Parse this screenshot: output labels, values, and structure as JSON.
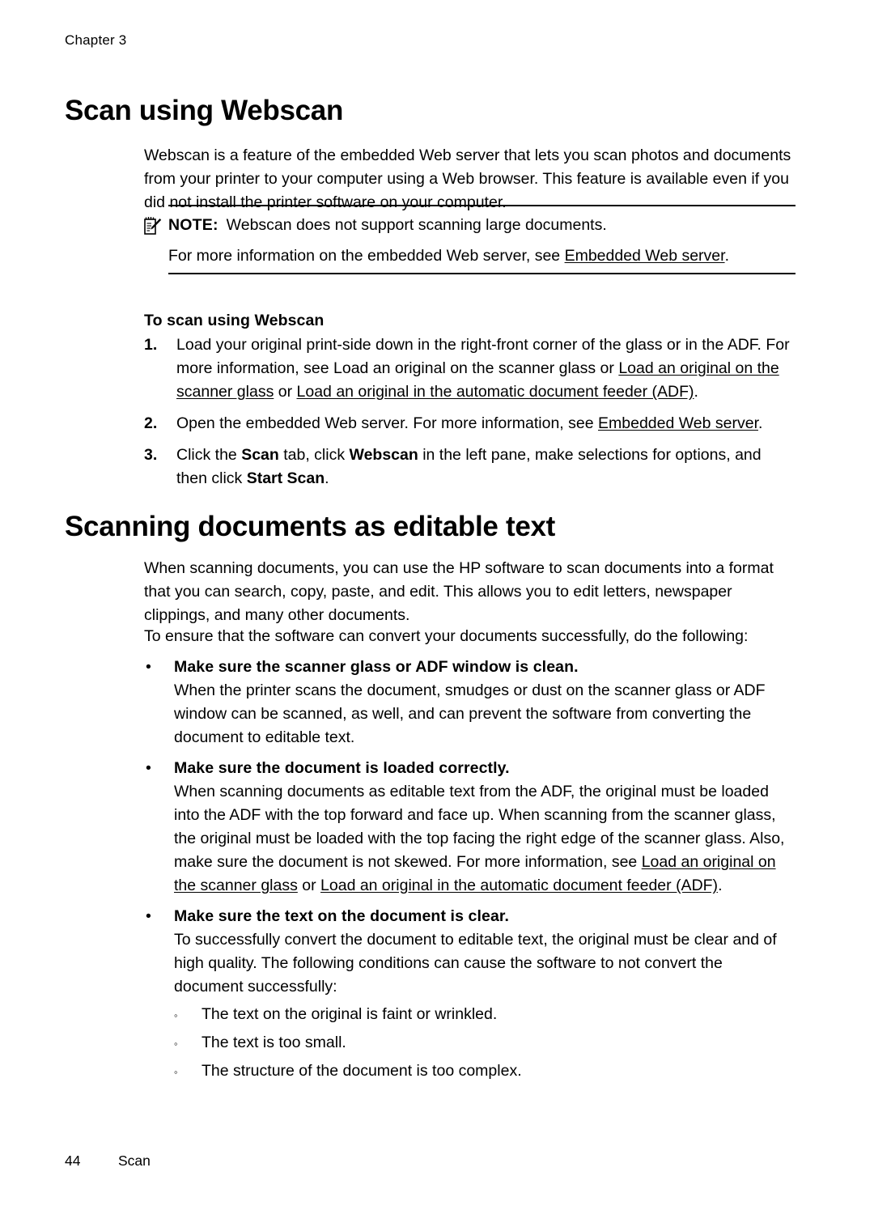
{
  "page": {
    "chapter_header": "Chapter 3",
    "footer_page_number": "44",
    "footer_section": "Scan"
  },
  "sections": [
    {
      "heading": "Scan using Webscan",
      "intro": "Webscan is a feature of the embedded Web server that lets you scan photos and documents from your printer to your computer using a Web browser. This feature is available even if you did not install the printer software on your computer.",
      "note": {
        "icon": "note-pencil-icon",
        "label": "NOTE:",
        "text": "Webscan does not support scanning large documents.",
        "second_line_prefix": "For more information on the embedded Web server, see ",
        "second_line_link": "Embedded Web server",
        "second_line_suffix": "."
      },
      "procedure_title": "To scan using Webscan",
      "steps": [
        {
          "number": "1.",
          "part1": "Load your original print-side down in the right-front corner of the glass or in the ADF. For more information, see Load an original on the scanner glass or ",
          "link1": "Load an original on the scanner glass",
          "mid": " or ",
          "link2": "Load an original in the automatic document feeder (ADF)",
          "tail": "."
        },
        {
          "number": "2.",
          "part1": "Open the embedded Web server. For more information, see ",
          "link1": "Embedded Web server",
          "tail": "."
        },
        {
          "number": "3.",
          "seg1": "Click the ",
          "bold1": "Scan",
          "seg2": " tab, click ",
          "bold2": "Webscan",
          "seg3": " in the left pane, make selections for options, and then click ",
          "bold3": "Start Scan",
          "seg4": "."
        }
      ]
    },
    {
      "heading": "Scanning documents as editable text",
      "intro": "When scanning documents, you can use the HP software to scan documents into a format that you can search, copy, paste, and edit. This allows you to edit letters, newspaper clippings, and many other documents.",
      "pre_bullets": "To ensure that the software can convert your documents successfully, do the following:",
      "bullets": [
        {
          "marker": "•",
          "title": "Make sure the scanner glass or ADF window is clean.",
          "text": "When the printer scans the document, smudges or dust on the scanner glass or ADF window can be scanned, as well, and can prevent the software from converting the document to editable text."
        },
        {
          "marker": "•",
          "title": "Make sure the document is loaded correctly.",
          "text_before": "When scanning documents as editable text from the ADF, the original must be loaded into the ADF with the top forward and face up. When scanning from the scanner glass, the original must be loaded with the top facing the right edge of the scanner glass. Also, make sure the document is not skewed. For more information, see ",
          "link1": "Load an original on the scanner glass",
          "mid": " or ",
          "link2": "Load an original in the automatic document feeder (ADF)",
          "tail": "."
        },
        {
          "marker": "•",
          "title": "Make sure the text on the document is clear.",
          "text": "To successfully convert the document to editable text, the original must be clear and of high quality. The following conditions can cause the software to not convert the document successfully:",
          "sub_marker": "◦",
          "sub_items": [
            "The text on the original is faint or wrinkled.",
            "The text is too small.",
            "The structure of the document is too complex."
          ]
        }
      ]
    }
  ]
}
